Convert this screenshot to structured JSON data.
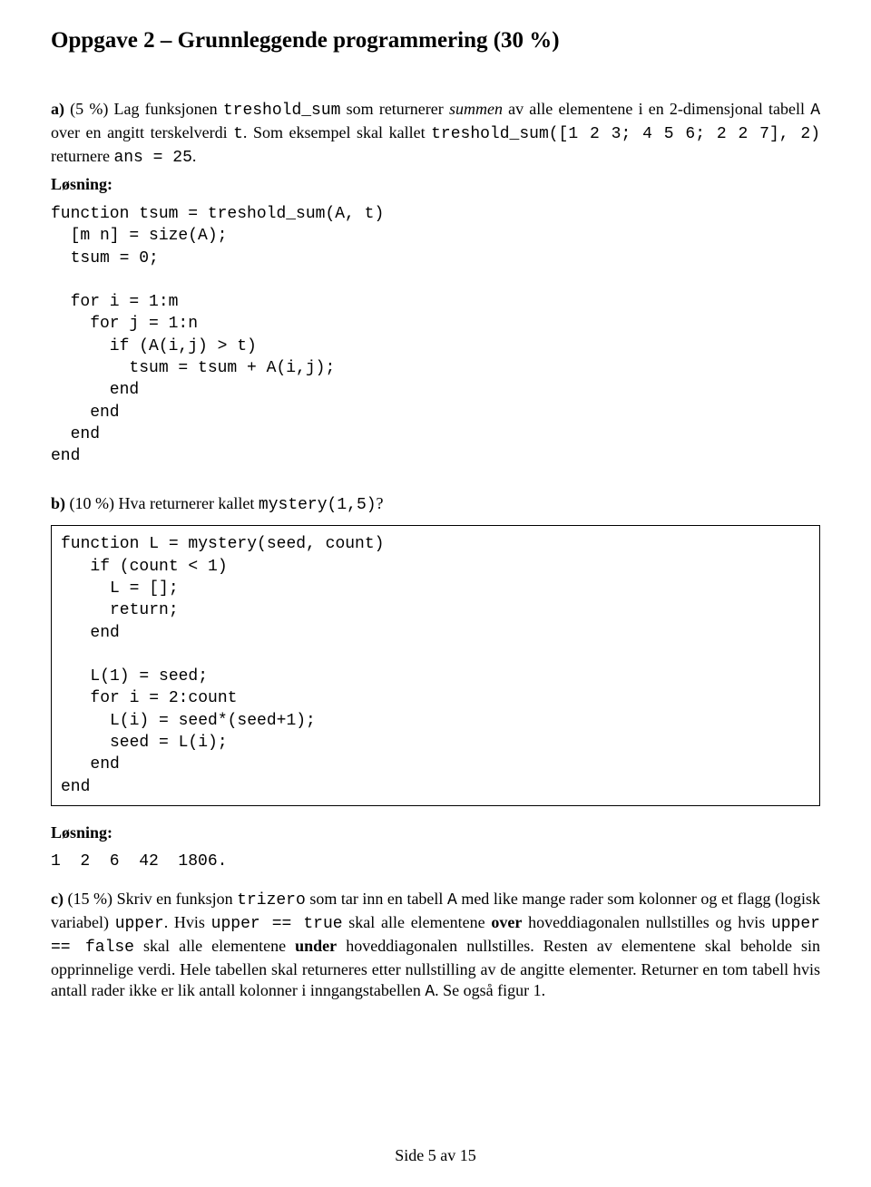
{
  "title": "Oppgave 2 – Grunnleggende programmering (30 %)",
  "a": {
    "label": "a)",
    "pct": " (5 %) ",
    "t1": "Lag funksjonen ",
    "code1": "treshold_sum",
    "t2": " som returnerer ",
    "ital": "summen",
    "t3": " av alle elementene i en 2-dimensjonal tabell ",
    "code2": "A",
    "t4": " over en angitt terskelverdi ",
    "code3": "t",
    "t5": ". Som eksempel skal kallet ",
    "code4": "treshold_sum([1 2 3; 4 5 6; 2 2 7], 2)",
    "t6": " returnere ",
    "code5": "ans = 25",
    "t7": "."
  },
  "solution_label": "Løsning:",
  "code_a": "function tsum = treshold_sum(A, t)\n  [m n] = size(A);\n  tsum = 0;\n\n  for i = 1:m\n    for j = 1:n\n      if (A(i,j) > t)\n        tsum = tsum + A(i,j);\n      end\n    end\n  end\nend",
  "b": {
    "label": "b)",
    "pct": " (10 %) ",
    "t1": "Hva returnerer kallet ",
    "code1": "mystery(1,5)",
    "t2": "?"
  },
  "code_b": "function L = mystery(seed, count)\n   if (count < 1)\n     L = [];\n     return;\n   end\n\n   L(1) = seed;\n   for i = 2:count\n     L(i) = seed*(seed+1);\n     seed = L(i);\n   end\nend",
  "answer_b": "1  2  6  42  1806.",
  "c": {
    "label": "c)",
    "pct": " (15 %) ",
    "t1": "Skriv en funksjon ",
    "code1": "trizero",
    "t2": " som tar inn en tabell ",
    "code2": "A",
    "t3": " med like mange rader som kolonner og et flagg (logisk variabel) ",
    "code3": "upper",
    "t4": ". Hvis ",
    "code4": "upper == true",
    "t5": " skal alle elementene ",
    "bold1": "over",
    "t6": " hoveddiagonalen nullstilles og hvis ",
    "code5": "upper == false",
    "t7": " skal alle elementene ",
    "bold2": "under",
    "t8": " hoveddiagonalen nullstilles. Resten av elementene skal beholde sin opprinnelige verdi. Hele tabellen skal returneres etter nullstilling av de angitte elementer. Returner en tom tabell hvis antall rader ikke er lik antall kolonner i inngangstabellen ",
    "code6": "A",
    "t9": ". Se også figur 1."
  },
  "footer": "Side 5 av 15"
}
